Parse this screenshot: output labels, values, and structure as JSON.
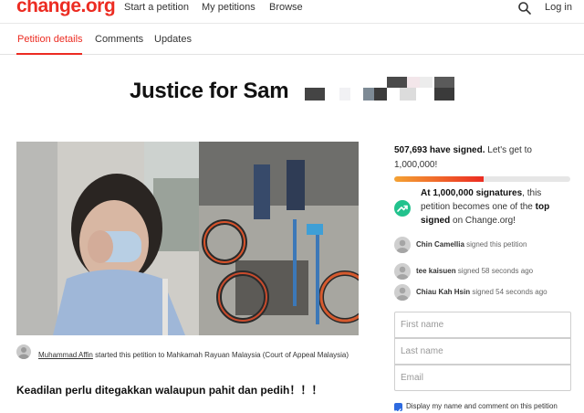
{
  "header": {
    "logo": "change.org",
    "nav": [
      "Start a petition",
      "My petitions",
      "Browse"
    ],
    "login": "Log in"
  },
  "tabs": [
    "Petition details",
    "Comments",
    "Updates"
  ],
  "petition": {
    "title": "Justice for Sam",
    "starter_name": "Muhammad Affin",
    "starter_text": " started this petition to Mahkamah Rayuan Malaysia (Court of Appeal Malaysia)",
    "excerpt": "Keadilan perlu ditegakkan walaupun pahit dan pedih！！！"
  },
  "signatures": {
    "count_text": "507,693 have signed.",
    "goal_text": " Let's get to 1,000,000!",
    "progress_fraction": 0.508,
    "milestone_bold": "At 1,000,000 signatures",
    "milestone_mid": ", this petition becomes one of the ",
    "milestone_top": "top signed",
    "milestone_end": " on Change.org!"
  },
  "recent_signers": [
    {
      "name": "Chin Camellia",
      "action": " signed this petition"
    },
    {
      "name": "tee kaisuen",
      "action": " signed 58 seconds ago"
    },
    {
      "name": "Chiau Kah Hsin",
      "action": " signed 54 seconds ago"
    }
  ],
  "form": {
    "first_name_placeholder": "First name",
    "last_name_placeholder": "Last name",
    "email_placeholder": "Email",
    "display_checkbox_label": "Display my name and comment on this petition"
  },
  "colors": {
    "brand": "#ec2c22",
    "milestone": "#22c28d",
    "checkbox": "#2d6ae0"
  }
}
